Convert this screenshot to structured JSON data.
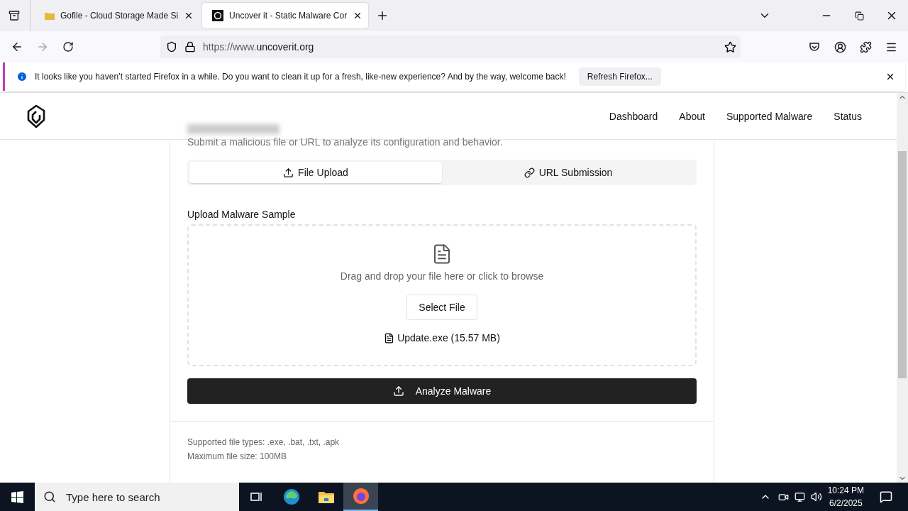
{
  "browser": {
    "tabs": [
      {
        "title": "Gofile - Cloud Storage Made Si",
        "selected": false
      },
      {
        "title": "Uncover it - Static Malware Cor",
        "selected": true
      }
    ],
    "url_prefix": "https://www.",
    "url_domain": "uncoverit.org",
    "notification": {
      "message": "It looks like you haven’t started Firefox in a while. Do you want to clean it up for a fresh, like-new experience? And by the way, welcome back!",
      "button": "Refresh Firefox..."
    }
  },
  "site": {
    "nav": [
      "Dashboard",
      "About",
      "Supported Malware",
      "Status"
    ],
    "subtitle": "Submit a malicious file or URL to analyze its configuration and behavior.",
    "modes": [
      {
        "label": "File Upload",
        "selected": true,
        "kind": "upload"
      },
      {
        "label": "URL Submission",
        "selected": false,
        "kind": "link"
      }
    ],
    "upload": {
      "label": "Upload Malware Sample",
      "hint": "Drag and drop your file here or click to browse",
      "button": "Select File",
      "file": "Update.exe (15.57 MB)"
    },
    "submit": "Analyze Malware",
    "notes": [
      "Supported file types: .exe, .bat, .txt, .apk",
      "Maximum file size: 100MB"
    ]
  },
  "taskbar": {
    "search_placeholder": "Type here to search",
    "time": "10:24 PM",
    "date": "6/2/2025"
  }
}
